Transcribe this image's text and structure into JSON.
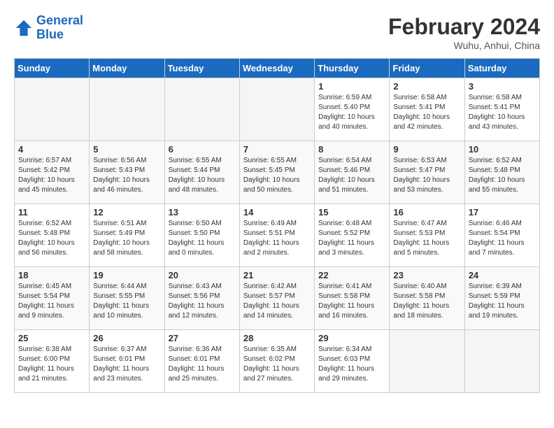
{
  "header": {
    "logo_line1": "General",
    "logo_line2": "Blue",
    "month_year": "February 2024",
    "location": "Wuhu, Anhui, China"
  },
  "days_of_week": [
    "Sunday",
    "Monday",
    "Tuesday",
    "Wednesday",
    "Thursday",
    "Friday",
    "Saturday"
  ],
  "weeks": [
    [
      {
        "day": "",
        "empty": true
      },
      {
        "day": "",
        "empty": true
      },
      {
        "day": "",
        "empty": true
      },
      {
        "day": "",
        "empty": true
      },
      {
        "day": "1",
        "sunrise": "6:59 AM",
        "sunset": "5:40 PM",
        "daylight": "10 hours and 40 minutes."
      },
      {
        "day": "2",
        "sunrise": "6:58 AM",
        "sunset": "5:41 PM",
        "daylight": "10 hours and 42 minutes."
      },
      {
        "day": "3",
        "sunrise": "6:58 AM",
        "sunset": "5:41 PM",
        "daylight": "10 hours and 43 minutes."
      }
    ],
    [
      {
        "day": "4",
        "sunrise": "6:57 AM",
        "sunset": "5:42 PM",
        "daylight": "10 hours and 45 minutes."
      },
      {
        "day": "5",
        "sunrise": "6:56 AM",
        "sunset": "5:43 PM",
        "daylight": "10 hours and 46 minutes."
      },
      {
        "day": "6",
        "sunrise": "6:55 AM",
        "sunset": "5:44 PM",
        "daylight": "10 hours and 48 minutes."
      },
      {
        "day": "7",
        "sunrise": "6:55 AM",
        "sunset": "5:45 PM",
        "daylight": "10 hours and 50 minutes."
      },
      {
        "day": "8",
        "sunrise": "6:54 AM",
        "sunset": "5:46 PM",
        "daylight": "10 hours and 51 minutes."
      },
      {
        "day": "9",
        "sunrise": "6:53 AM",
        "sunset": "5:47 PM",
        "daylight": "10 hours and 53 minutes."
      },
      {
        "day": "10",
        "sunrise": "6:52 AM",
        "sunset": "5:48 PM",
        "daylight": "10 hours and 55 minutes."
      }
    ],
    [
      {
        "day": "11",
        "sunrise": "6:52 AM",
        "sunset": "5:48 PM",
        "daylight": "10 hours and 56 minutes."
      },
      {
        "day": "12",
        "sunrise": "6:51 AM",
        "sunset": "5:49 PM",
        "daylight": "10 hours and 58 minutes."
      },
      {
        "day": "13",
        "sunrise": "6:50 AM",
        "sunset": "5:50 PM",
        "daylight": "11 hours and 0 minutes."
      },
      {
        "day": "14",
        "sunrise": "6:49 AM",
        "sunset": "5:51 PM",
        "daylight": "11 hours and 2 minutes."
      },
      {
        "day": "15",
        "sunrise": "6:48 AM",
        "sunset": "5:52 PM",
        "daylight": "11 hours and 3 minutes."
      },
      {
        "day": "16",
        "sunrise": "6:47 AM",
        "sunset": "5:53 PM",
        "daylight": "11 hours and 5 minutes."
      },
      {
        "day": "17",
        "sunrise": "6:46 AM",
        "sunset": "5:54 PM",
        "daylight": "11 hours and 7 minutes."
      }
    ],
    [
      {
        "day": "18",
        "sunrise": "6:45 AM",
        "sunset": "5:54 PM",
        "daylight": "11 hours and 9 minutes."
      },
      {
        "day": "19",
        "sunrise": "6:44 AM",
        "sunset": "5:55 PM",
        "daylight": "11 hours and 10 minutes."
      },
      {
        "day": "20",
        "sunrise": "6:43 AM",
        "sunset": "5:56 PM",
        "daylight": "11 hours and 12 minutes."
      },
      {
        "day": "21",
        "sunrise": "6:42 AM",
        "sunset": "5:57 PM",
        "daylight": "11 hours and 14 minutes."
      },
      {
        "day": "22",
        "sunrise": "6:41 AM",
        "sunset": "5:58 PM",
        "daylight": "11 hours and 16 minutes."
      },
      {
        "day": "23",
        "sunrise": "6:40 AM",
        "sunset": "5:58 PM",
        "daylight": "11 hours and 18 minutes."
      },
      {
        "day": "24",
        "sunrise": "6:39 AM",
        "sunset": "5:59 PM",
        "daylight": "11 hours and 19 minutes."
      }
    ],
    [
      {
        "day": "25",
        "sunrise": "6:38 AM",
        "sunset": "6:00 PM",
        "daylight": "11 hours and 21 minutes."
      },
      {
        "day": "26",
        "sunrise": "6:37 AM",
        "sunset": "6:01 PM",
        "daylight": "11 hours and 23 minutes."
      },
      {
        "day": "27",
        "sunrise": "6:36 AM",
        "sunset": "6:01 PM",
        "daylight": "11 hours and 25 minutes."
      },
      {
        "day": "28",
        "sunrise": "6:35 AM",
        "sunset": "6:02 PM",
        "daylight": "11 hours and 27 minutes."
      },
      {
        "day": "29",
        "sunrise": "6:34 AM",
        "sunset": "6:03 PM",
        "daylight": "11 hours and 29 minutes."
      },
      {
        "day": "",
        "empty": true
      },
      {
        "day": "",
        "empty": true
      }
    ]
  ],
  "labels": {
    "sunrise": "Sunrise:",
    "sunset": "Sunset:",
    "daylight": "Daylight:"
  }
}
